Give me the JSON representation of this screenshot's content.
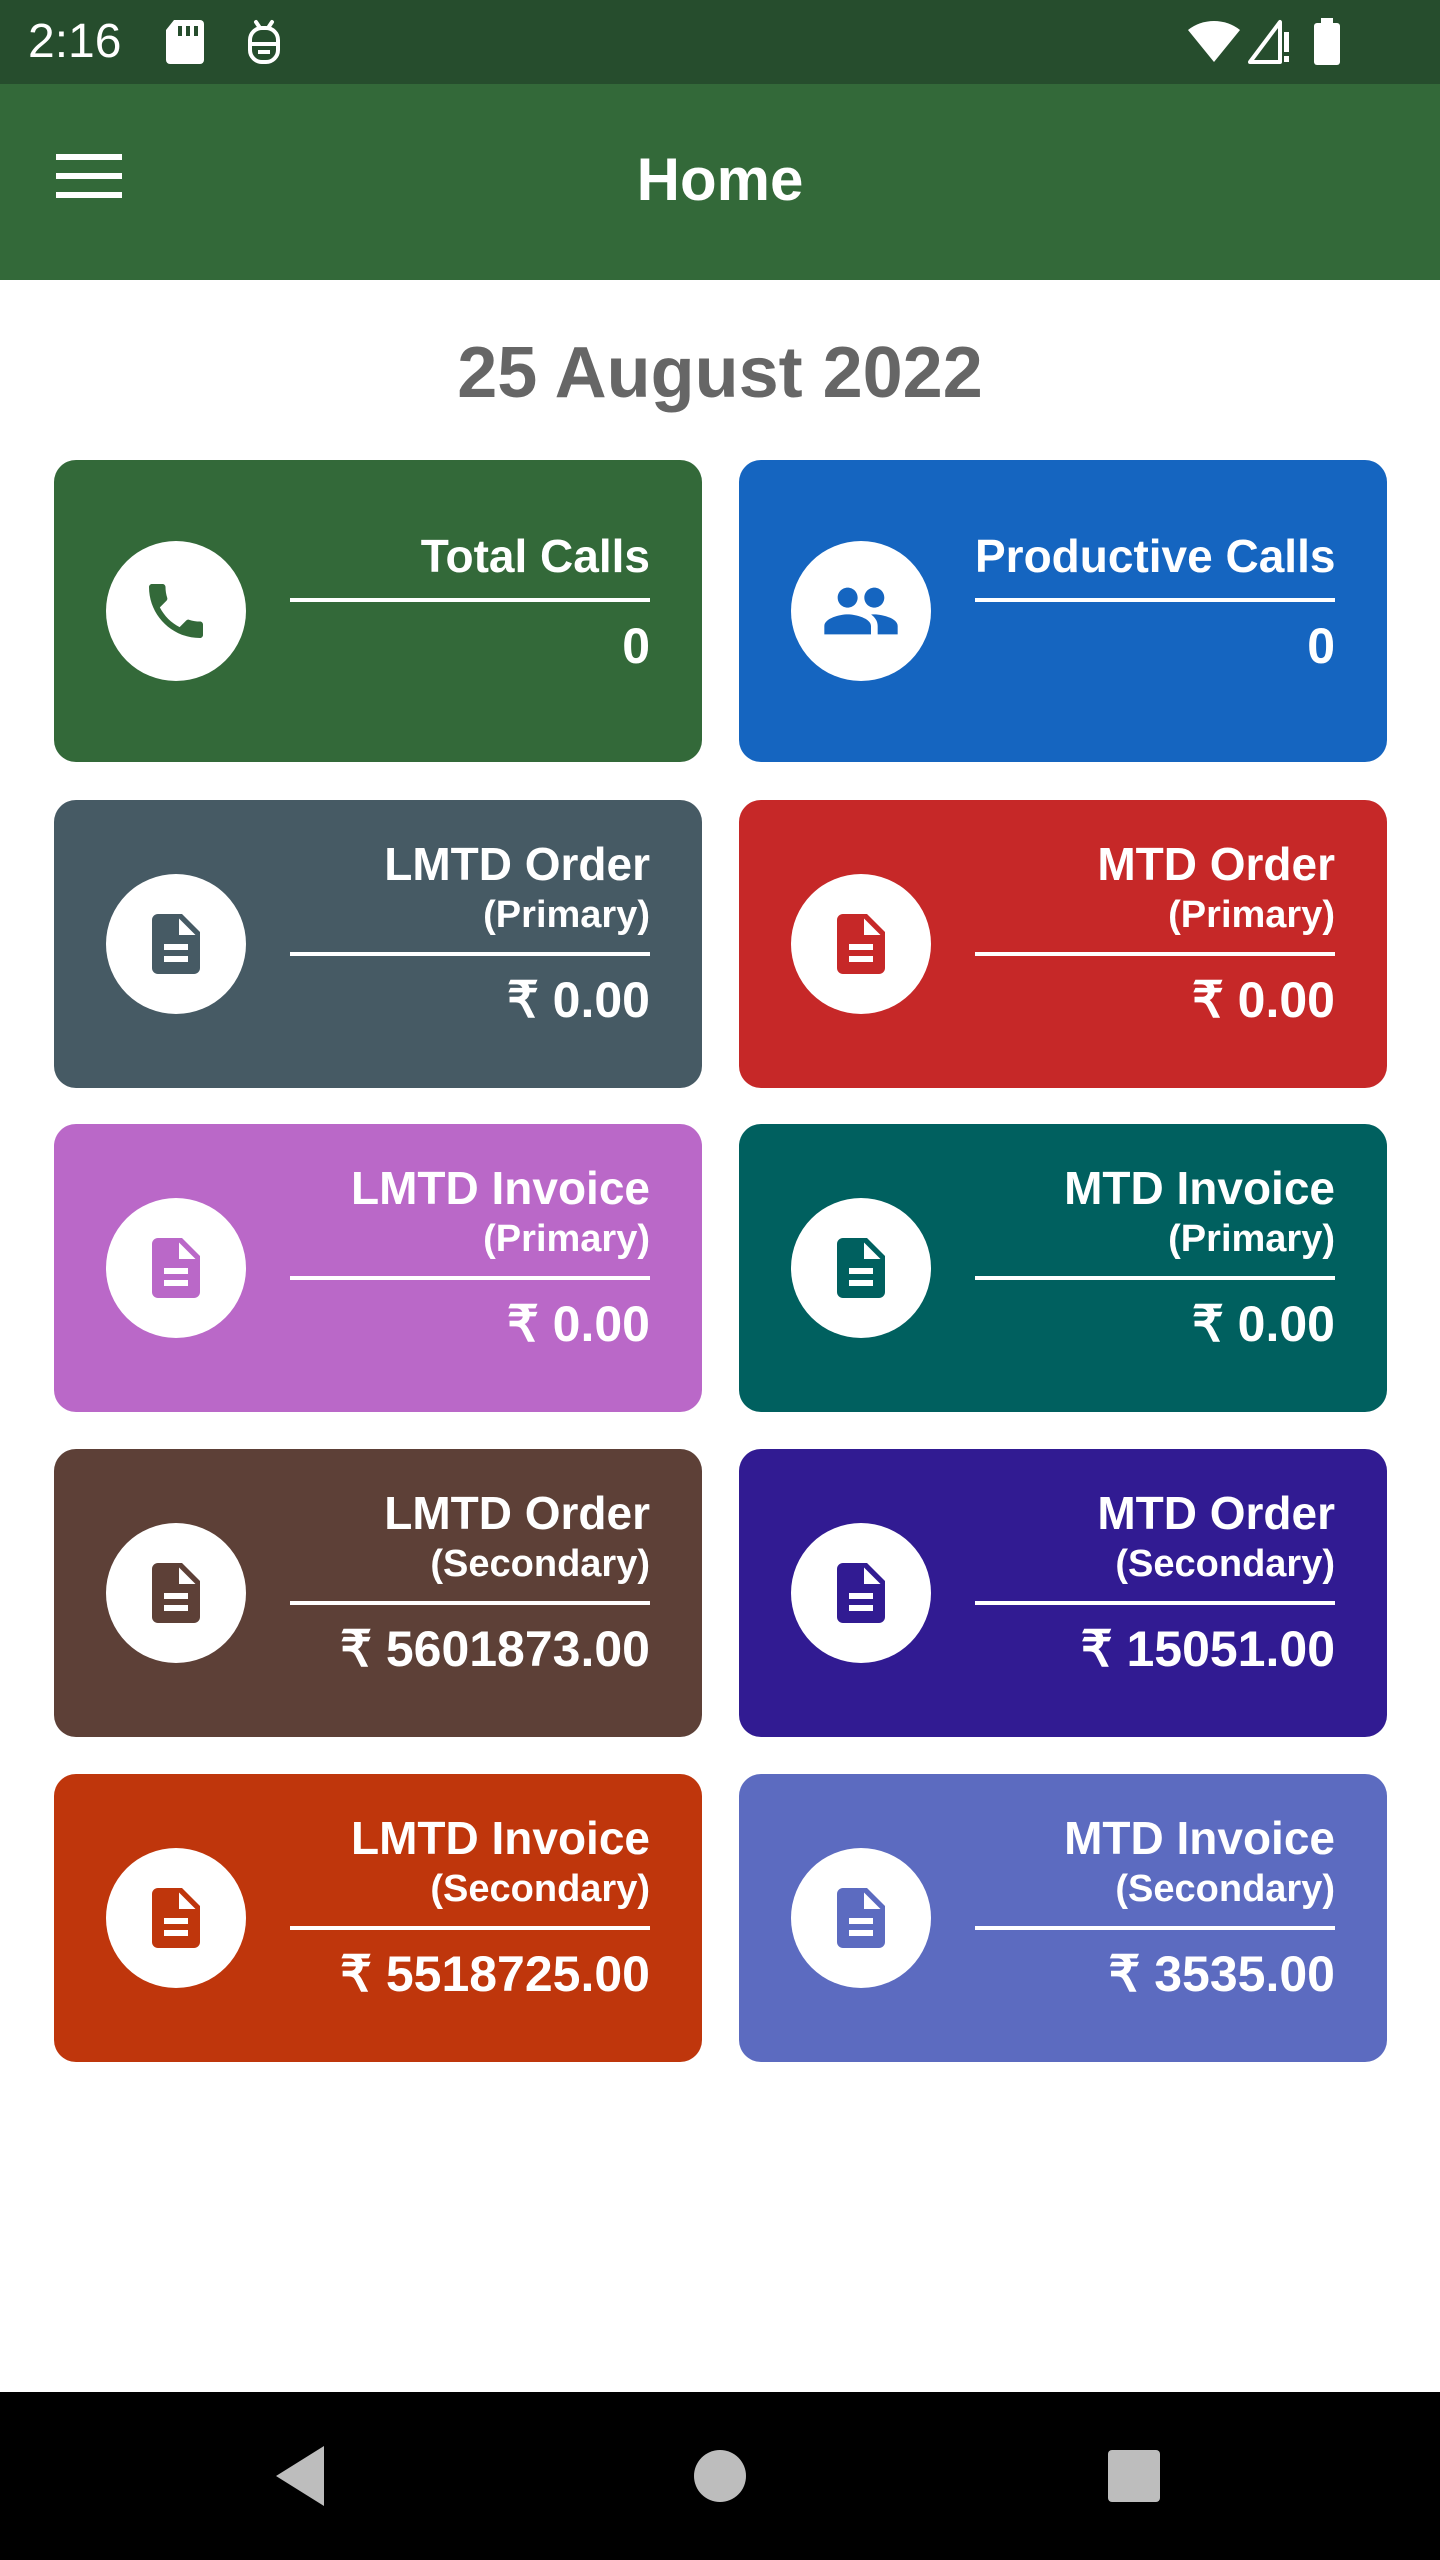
{
  "status_bar": {
    "time": "2:16",
    "icons": [
      "sd-card-icon",
      "debug-icon",
      "wifi-icon",
      "signal-icon",
      "battery-icon"
    ]
  },
  "app_bar": {
    "title": "Home",
    "menu_icon": "hamburger-menu-icon",
    "background": "#336939"
  },
  "date": "25 August 2022",
  "cards": [
    {
      "id": "total-calls",
      "title": "Total Calls",
      "subtitle": "",
      "value": "0",
      "icon": "phone-icon",
      "color": "#336939"
    },
    {
      "id": "productive-calls",
      "title": "Productive Calls",
      "subtitle": "",
      "value": "0",
      "icon": "people-icon",
      "color": "#1565c0"
    },
    {
      "id": "lmtd-order-primary",
      "title": "LMTD Order",
      "subtitle": "(Primary)",
      "value": "₹ 0.00",
      "icon": "document-icon",
      "color": "#465a64"
    },
    {
      "id": "mtd-order-primary",
      "title": "MTD Order",
      "subtitle": "(Primary)",
      "value": "₹ 0.00",
      "icon": "document-icon",
      "color": "#c62828"
    },
    {
      "id": "lmtd-invoice-primary",
      "title": "LMTD Invoice",
      "subtitle": "(Primary)",
      "value": "₹ 0.00",
      "icon": "document-icon",
      "color": "#ba68c8"
    },
    {
      "id": "mtd-invoice-primary",
      "title": "MTD Invoice",
      "subtitle": "(Primary)",
      "value": "₹ 0.00",
      "icon": "document-icon",
      "color": "#00605f"
    },
    {
      "id": "lmtd-order-secondary",
      "title": "LMTD Order",
      "subtitle": "(Secondary)",
      "value": "₹ 5601873.00",
      "icon": "document-icon",
      "color": "#5d4037"
    },
    {
      "id": "mtd-order-secondary",
      "title": "MTD Order",
      "subtitle": "(Secondary)",
      "value": "₹ 15051.00",
      "icon": "document-icon",
      "color": "#311b92"
    },
    {
      "id": "lmtd-invoice-secondary",
      "title": "LMTD Invoice",
      "subtitle": "(Secondary)",
      "value": "₹ 5518725.00",
      "icon": "document-icon",
      "color": "#bf360c"
    },
    {
      "id": "mtd-invoice-secondary",
      "title": "MTD Invoice",
      "subtitle": "(Secondary)",
      "value": "₹ 3535.00",
      "icon": "document-icon",
      "color": "#5c6bc0"
    }
  ],
  "nav_bar": {
    "buttons": [
      "back-icon",
      "home-icon",
      "recents-icon"
    ]
  }
}
